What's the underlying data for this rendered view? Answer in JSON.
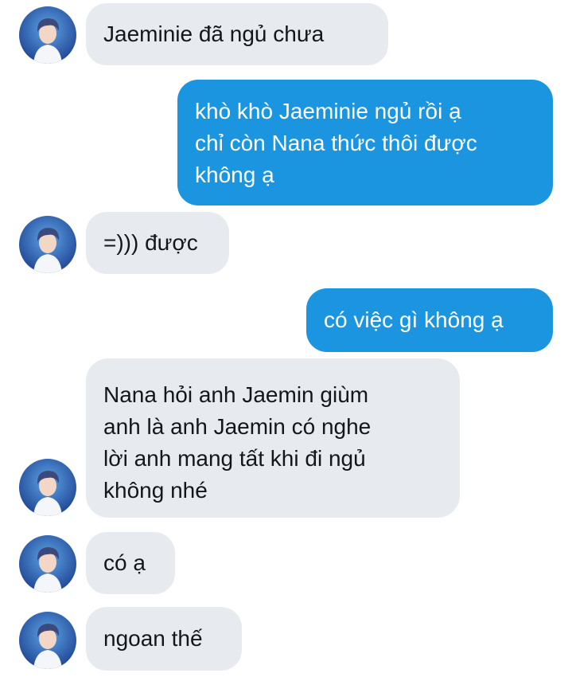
{
  "conversation": {
    "messages": [
      {
        "sender": "other",
        "text": "Jaeminie đã ngủ chưa"
      },
      {
        "sender": "me",
        "text": "khò khò Jaeminie ngủ rồi ạ\nchỉ còn Nana thức thôi được\nkhông ạ"
      },
      {
        "sender": "other",
        "text": "=))) được"
      },
      {
        "sender": "me",
        "text": "có việc gì không ạ"
      },
      {
        "sender": "other",
        "text": "Nana hỏi anh Jaemin giùm\nanh là anh Jaemin có nghe\nlời anh mang tất khi đi ngủ\nkhông nhé"
      },
      {
        "sender": "other",
        "text": "có ạ"
      },
      {
        "sender": "other",
        "text": "ngoan thế"
      }
    ]
  },
  "colors": {
    "incoming_bubble": "#e7ebf0",
    "outgoing_bubble": "#1b95e0",
    "incoming_text": "#14171a",
    "outgoing_text": "#ffffff",
    "background": "#ffffff"
  },
  "icons": {
    "avatar": "profile-photo-avatar"
  }
}
